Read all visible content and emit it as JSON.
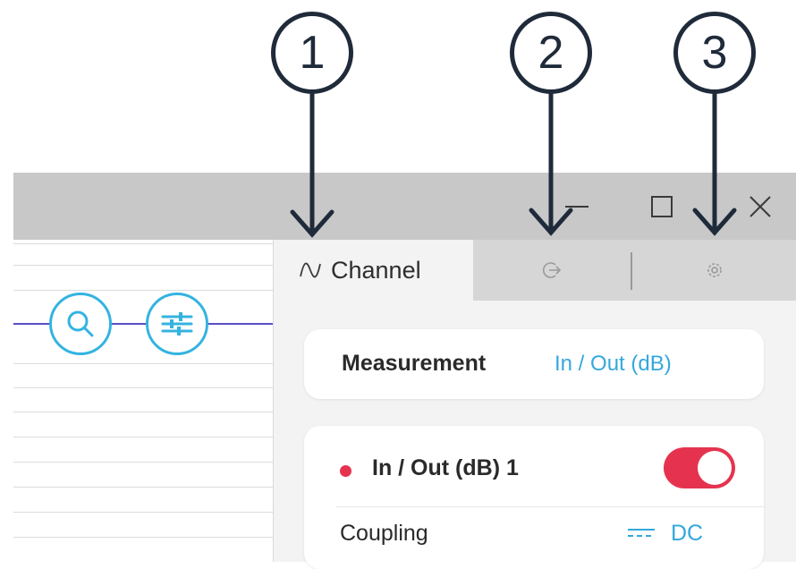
{
  "window": {
    "controls": {
      "minimize": "minimize-icon",
      "maximize": "maximize-icon",
      "close": "close-icon"
    }
  },
  "graph": {
    "buttons": [
      {
        "icon": "search-icon"
      },
      {
        "icon": "sliders-icon"
      }
    ],
    "trace_color": "#5b4ec7"
  },
  "tabs": {
    "channel": {
      "icon": "wave-icon",
      "label": "Channel"
    },
    "output": {
      "icon": "output-icon"
    },
    "settings": {
      "icon": "gear-icon"
    }
  },
  "measurement": {
    "label": "Measurement",
    "value": "In / Out (dB)"
  },
  "channel": {
    "name": "In / Out (dB) 1",
    "dot_color": "#e5334f",
    "enabled": true,
    "coupling_label": "Coupling",
    "coupling_icon": "dc-coupling-icon",
    "coupling_value": "DC"
  },
  "callouts": [
    "1",
    "2",
    "3"
  ],
  "colors": {
    "accent": "#34a8dc",
    "toggle_on": "#e5334f",
    "callout": "#1f2a3a"
  }
}
